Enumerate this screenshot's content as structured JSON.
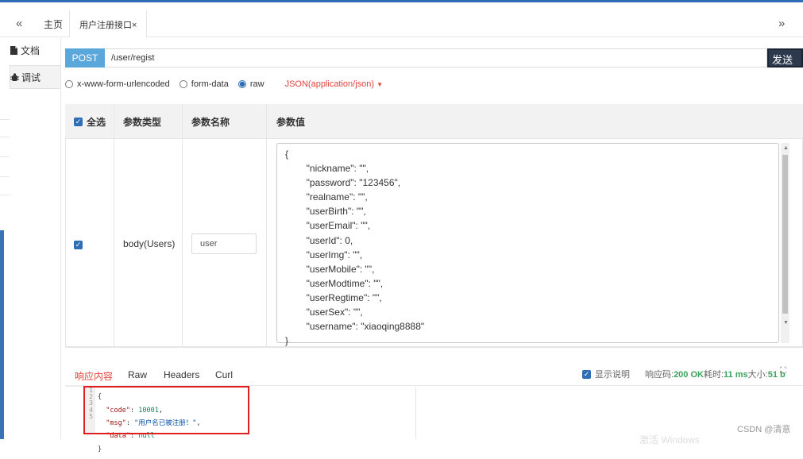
{
  "tabs": {
    "collapse": "«",
    "home": "主页",
    "active": "用户注册接口×",
    "expand": "»"
  },
  "sidebar": {
    "items": [
      {
        "label": "文档",
        "icon": "document-icon"
      },
      {
        "label": "调试",
        "icon": "debug-icon"
      }
    ]
  },
  "request": {
    "method": "POST",
    "url": "/user/regist",
    "send_label": "发送"
  },
  "body_type": {
    "options": [
      "x-www-form-urlencoded",
      "form-data",
      "raw"
    ],
    "selected": "raw",
    "content_type": "JSON(application/json)"
  },
  "params": {
    "headers": [
      "全选",
      "参数类型",
      "参数名称",
      "参数值"
    ],
    "rows": [
      {
        "checked": true,
        "type": "body(Users)",
        "name": "user",
        "value_lines": [
          "{",
          "        \"nickname\": \"\",",
          "        \"password\": \"123456\",",
          "        \"realname\": \"\",",
          "        \"userBirth\": \"\",",
          "        \"userEmail\": \"\",",
          "        \"userId\": 0,",
          "        \"userImg\": \"\",",
          "        \"userMobile\": \"\",",
          "        \"userModtime\": \"\",",
          "        \"userRegtime\": \"\",",
          "        \"userSex\": \"\",",
          "        \"username\": \"xiaoqing8888\"",
          "}"
        ]
      }
    ]
  },
  "response": {
    "tabs": [
      "响应内容",
      "Raw",
      "Headers",
      "Curl"
    ],
    "active_tab": "响应内容",
    "show_desc": "显示说明",
    "code_label": "响应码:",
    "code_value": "200 OK",
    "time_label": "耗时:",
    "time_value": "11 ms",
    "size_label": "大小:",
    "size_value": "51 b",
    "line_numbers": [
      "1",
      "2",
      "3",
      "4",
      "5"
    ],
    "body": {
      "code_key": "\"code\"",
      "code_val": "10001",
      "msg_key": "\"msg\"",
      "msg_val": "\"用户名已被注册！\"",
      "data_key": "\"data\"",
      "data_val": "null"
    }
  },
  "watermark": "CSDN @清意",
  "watermark2": "激活 Windows"
}
